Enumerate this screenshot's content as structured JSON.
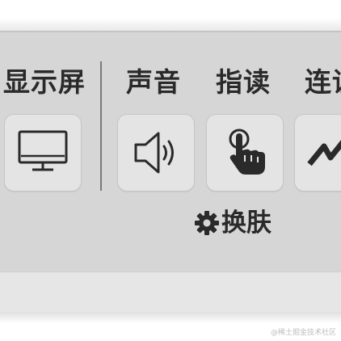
{
  "toolbar": {
    "items": [
      {
        "label": "显示屏",
        "icon": "monitor-icon"
      },
      {
        "label": "声音",
        "icon": "speaker-icon"
      },
      {
        "label": "指读",
        "icon": "pointing-hand-icon"
      },
      {
        "label": "连读",
        "icon": "zigzag-icon"
      }
    ]
  },
  "skin": {
    "label": "换肤",
    "icon": "gear-icon"
  },
  "watermark": "@稀土掘金技术社区",
  "colors": {
    "panel_bg": "#d6d6d6",
    "button_bg": "#e4e4e4",
    "text": "#2a2a2a"
  }
}
